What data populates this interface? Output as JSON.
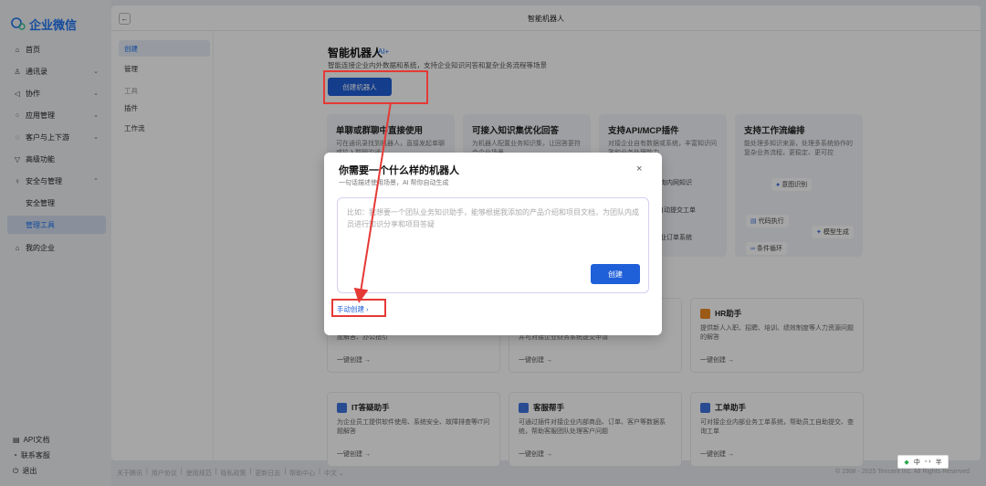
{
  "app": {
    "logo_text": "企业微信",
    "page_title": "智能机器人"
  },
  "nav": {
    "items": [
      {
        "label": "首页",
        "icon": "home-icon"
      },
      {
        "label": "通讯录",
        "icon": "contacts-icon"
      },
      {
        "label": "协作",
        "icon": "collab-icon"
      },
      {
        "label": "应用管理",
        "icon": "apps-icon"
      },
      {
        "label": "客户与上下游",
        "icon": "customer-icon"
      },
      {
        "label": "高级功能",
        "icon": "advanced-icon"
      },
      {
        "label": "安全与管理",
        "icon": "security-icon"
      },
      {
        "label": "安全管理"
      },
      {
        "label": "管理工具"
      },
      {
        "label": "我的企业",
        "icon": "company-icon"
      }
    ],
    "footer": [
      {
        "label": "API文档",
        "icon": "doc-icon"
      },
      {
        "label": "联系客服",
        "icon": "support-icon"
      },
      {
        "label": "退出",
        "icon": "logout-icon"
      }
    ]
  },
  "subnav": [
    "创建",
    "管理",
    "工具",
    "插件",
    "工作流"
  ],
  "main": {
    "heading": "智能机器人",
    "ai_tag": "AI+",
    "description": "智能连接企业内外数据和系统，支持企业知识问答和复杂业务流程等场景",
    "create_button": "创建机器人"
  },
  "features": [
    {
      "title": "单聊或群聊中直接使用",
      "desc": "可在通讯录找到机器人，直接发起单聊或拉入群聊沟通。"
    },
    {
      "title": "可接入知识集优化回答",
      "desc": "为机器人配置业务知识集，让回答更符合企业场景"
    },
    {
      "title": "支持API/MCP插件",
      "desc": "对接企业自有数据或系统，丰富知识问答和业务处理能力"
    },
    {
      "title": "支持工作流编排",
      "desc": "能处理多知识来源，处理多系统协作的复杂业务流程，更稳定、更可控"
    }
  ],
  "feature_snippets": {
    "plugin_1": "查询内网知识",
    "plugin_2": "自动提交工单",
    "plugin_3": "企业订单系统",
    "wf_1": "意图识别",
    "wf_2": "代码执行",
    "wf_3": "模型生成",
    "wf_4": "条件循环"
  },
  "templates": [
    {
      "title": "",
      "desc": "度解答、办公指引",
      "go": "一键创建 →"
    },
    {
      "title": "",
      "desc": "并可对接企业财务系统提交申请",
      "go": "一键创建 →"
    },
    {
      "title": "HR助手",
      "desc": "提供新人入职、招聘、培训、绩效制度等人力资源问题的解答",
      "go": "一键创建 →"
    },
    {
      "title": "IT答疑助手",
      "desc": "为企业员工提供软件使用、系统安全、故障排查等IT问题解答",
      "go": "一键创建 →"
    },
    {
      "title": "客服帮手",
      "desc": "可通过插件对接企业内部商品、订单、客户等数据系统，帮助客服团队处理客户问题",
      "go": "一键创建 →"
    },
    {
      "title": "工单助手",
      "desc": "可对接企业内部业务工单系统，帮助员工自助提交、查询工单",
      "go": "一键创建 →"
    }
  ],
  "footer": {
    "links": [
      "关于腾讯",
      "|",
      "用户协议",
      "|",
      "使用规范",
      "|",
      "隐私政策",
      "|",
      "更新日志",
      "|",
      "帮助中心",
      "|",
      "中文 ⌄"
    ],
    "copyright": "© 1998 - 2025 Tencent Inc. All Rights Reserved"
  },
  "ime": {
    "a": "中",
    "b": "◦ ›",
    "c": "半"
  },
  "modal": {
    "title": "你需要一个什么样的机器人",
    "subtitle": "一句话描述使用场景，AI 帮你自动生成",
    "placeholder": "比如：我想要一个团队业务知识助手，能够根据我添加的产品介绍和项目文档，为团队内成员进行知识分享和项目答疑",
    "create_label": "创建",
    "manual_label": "手动创建 ›",
    "close": "×"
  }
}
